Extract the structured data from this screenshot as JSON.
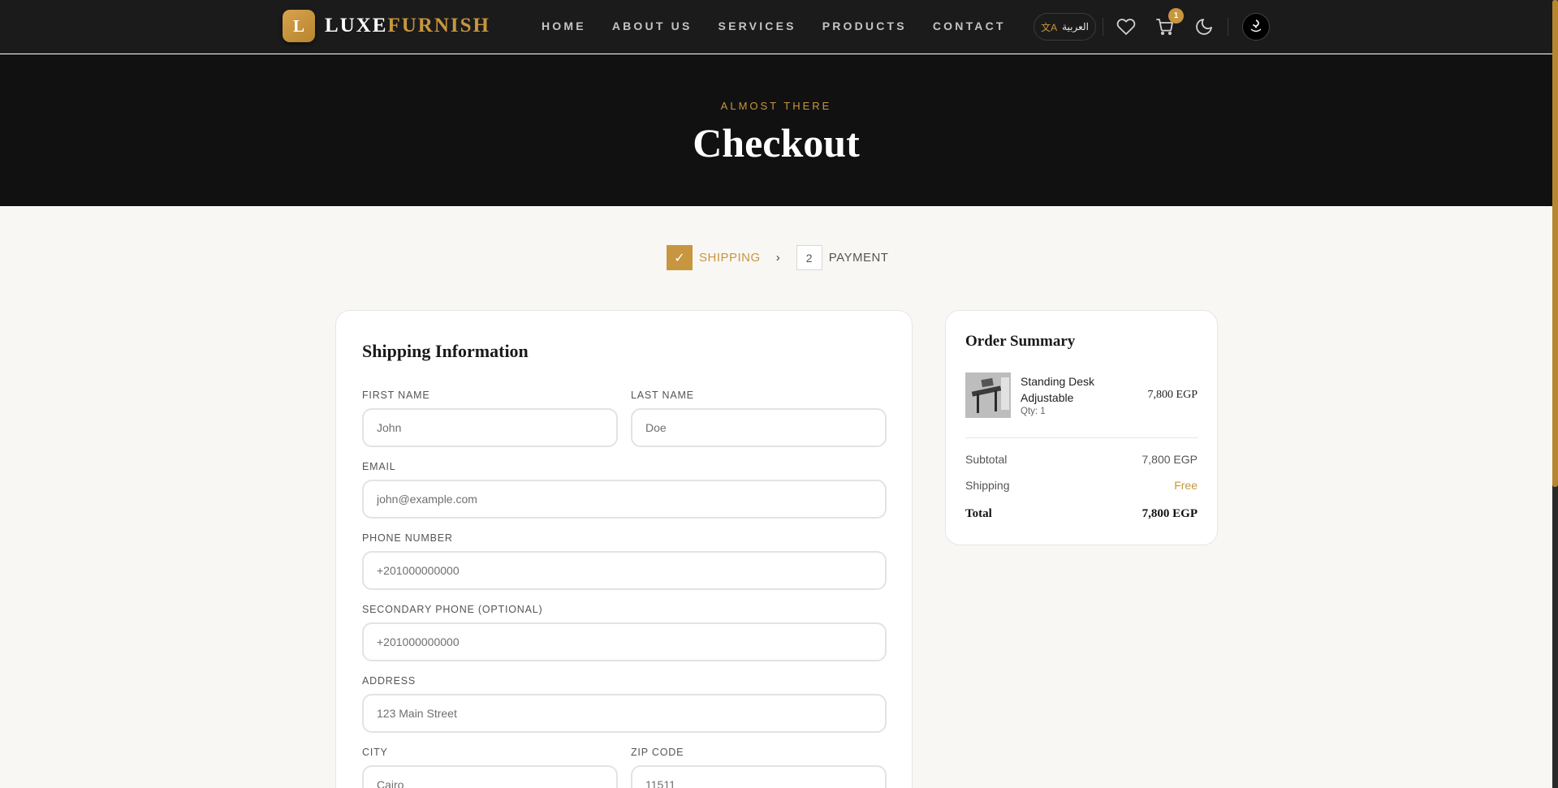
{
  "nav": {
    "logo_mark": "L",
    "logo_text_white": "LUXE",
    "logo_text_gold": "FURNISH",
    "links": [
      "HOME",
      "ABOUT US",
      "SERVICES",
      "PRODUCTS",
      "CONTACT"
    ],
    "language_label": "العربية",
    "cart_count": "1",
    "icons": [
      "translate-icon",
      "heart-icon",
      "cart-icon",
      "moon-icon",
      "avatar-logo"
    ]
  },
  "hero": {
    "eyebrow": "ALMOST THERE",
    "title": "Checkout"
  },
  "steps": {
    "step1_mark": "✓",
    "step1_label": "SHIPPING",
    "separator": "›",
    "step2_number": "2",
    "step2_label": "PAYMENT"
  },
  "shipping": {
    "title": "Shipping Information",
    "fields": [
      {
        "label": "FIRST NAME",
        "placeholder": "John",
        "value": ""
      },
      {
        "label": "LAST NAME",
        "placeholder": "Doe",
        "value": ""
      },
      {
        "label": "EMAIL",
        "placeholder": "john@example.com",
        "value": ""
      },
      {
        "label": "PHONE NUMBER",
        "placeholder": "+201000000000",
        "value": ""
      },
      {
        "label": "SECONDARY PHONE (OPTIONAL)",
        "placeholder": "+201000000000",
        "value": ""
      },
      {
        "label": "ADDRESS",
        "placeholder": "123 Main Street",
        "value": ""
      },
      {
        "label": "CITY",
        "placeholder": "Cairo",
        "value": ""
      },
      {
        "label": "ZIP CODE",
        "placeholder": "11511",
        "value": ""
      }
    ]
  },
  "summary": {
    "title": "Order Summary",
    "item": {
      "name": "Standing Desk Adjustable",
      "qty": "Qty: 1",
      "price": "7,800 EGP"
    },
    "subtotal_label": "Subtotal",
    "subtotal_value": "7,800 EGP",
    "shipping_label": "Shipping",
    "shipping_value": "Free",
    "total_label": "Total",
    "total_value": "7,800 EGP"
  },
  "colors": {
    "accent": "#c8963e",
    "nav_bg": "#1b1b1b",
    "hero_bg": "#111111",
    "page_bg": "#f8f7f4"
  }
}
